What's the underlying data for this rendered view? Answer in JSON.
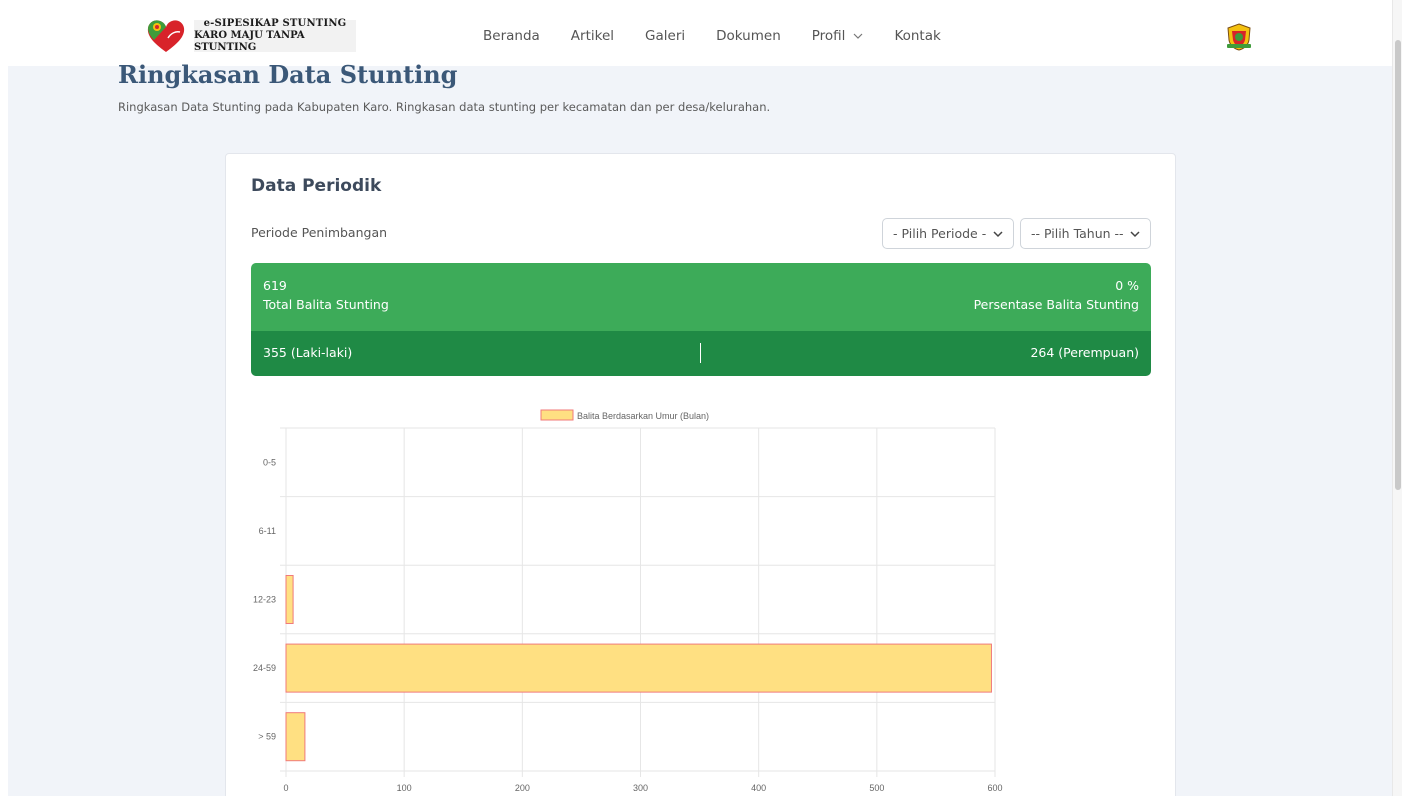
{
  "header": {
    "brand_line1": "e-SIPESIKAP STUNTING",
    "brand_line2": "KARO MAJU TANPA STUNTING",
    "nav": [
      "Beranda",
      "Artikel",
      "Galeri",
      "Dokumen",
      "Profil",
      "Kontak"
    ]
  },
  "page": {
    "title": "Ringkasan Data Stunting",
    "subtitle": "Ringkasan Data Stunting pada Kabupaten Karo. Ringkasan data stunting per kecamatan dan per desa/kelurahan."
  },
  "card": {
    "title": "Data Periodik",
    "periode_label": "Periode Penimbangan",
    "select_periode": "- Pilih Periode -",
    "select_tahun": "-- Pilih Tahun --",
    "total_value": "619",
    "total_label": "Total Balita Stunting",
    "pct_value": "0 %",
    "pct_label": "Persentase Balita Stunting",
    "male": "355 (Laki-laki)",
    "female": "264 (Perempuan)"
  },
  "colors": {
    "green": "#3dab59",
    "dark_green": "#1f8a45",
    "bar_fill": "#ffe082",
    "bar_border": "#f07a7a",
    "title": "#3b5878"
  },
  "chart_data": {
    "type": "bar",
    "orientation": "horizontal",
    "categories": [
      "0-5",
      "6-11",
      "12-23",
      "24-59",
      "> 59"
    ],
    "series": [
      {
        "name": "Balita Berdasarkan Umur (Bulan)",
        "values": [
          0,
          0,
          6,
          597,
          16
        ]
      }
    ],
    "xlim": [
      0,
      600
    ],
    "xticks": [
      0,
      100,
      200,
      300,
      400,
      500,
      600
    ],
    "grid": true,
    "legend": "top"
  }
}
